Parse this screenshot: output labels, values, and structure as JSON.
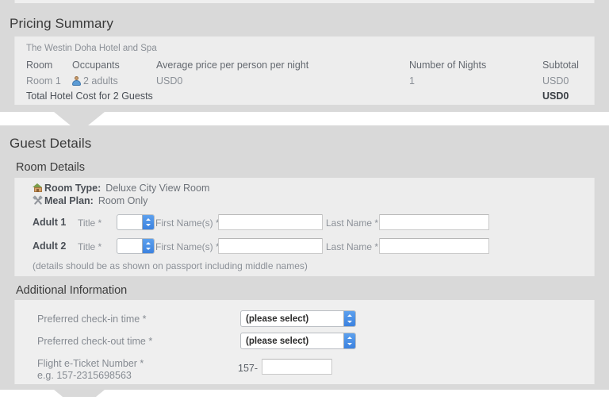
{
  "pricing": {
    "title": "Pricing Summary",
    "hotel_name": "The Westin Doha Hotel and Spa",
    "columns": {
      "room": "Room",
      "occupants": "Occupants",
      "average_price": "Average price per person per night",
      "nights": "Number of Nights",
      "subtotal": "Subtotal"
    },
    "rows": [
      {
        "room": "Room 1",
        "occupants": "2 adults",
        "occupants_icon": "person-icon",
        "average_price": "USD0",
        "nights": "1",
        "subtotal": "USD0"
      }
    ],
    "total": {
      "label": "Total Hotel Cost for 2 Guests",
      "amount": "USD0"
    }
  },
  "guest_details": {
    "title": "Guest Details",
    "room_details": {
      "title": "Room Details",
      "room_type_icon": "house-icon",
      "room_type_label": "Room Type:",
      "room_type_value": "Deluxe City View Room",
      "meal_plan_icon": "cutlery-icon",
      "meal_plan_label": "Meal Plan:",
      "meal_plan_value": "Room Only",
      "title_label": "Title *",
      "first_name_label": "First Name(s) *",
      "last_name_label": "Last Name *",
      "title_value": "",
      "first_name_value": "",
      "last_name_value": "",
      "adults": [
        {
          "label": "Adult 1"
        },
        {
          "label": "Adult 2"
        }
      ],
      "passport_note": "(details should be as shown on passport including middle names)"
    },
    "additional_information": {
      "title": "Additional Information",
      "checkin_label": "Preferred check-in time *",
      "checkin_value": "(please select)",
      "checkout_label": "Preferred check-out time *",
      "checkout_value": "(please select)",
      "eticket_label": "Flight e-Ticket Number *",
      "eticket_hint": "e.g. 157-2315698563",
      "eticket_prefix": "157-",
      "eticket_value": ""
    }
  },
  "colors": {
    "panel": "#d9d9d9",
    "content_box": "#ededed",
    "accent_blue": "#3c82df",
    "muted_text": "#8a8f96"
  }
}
